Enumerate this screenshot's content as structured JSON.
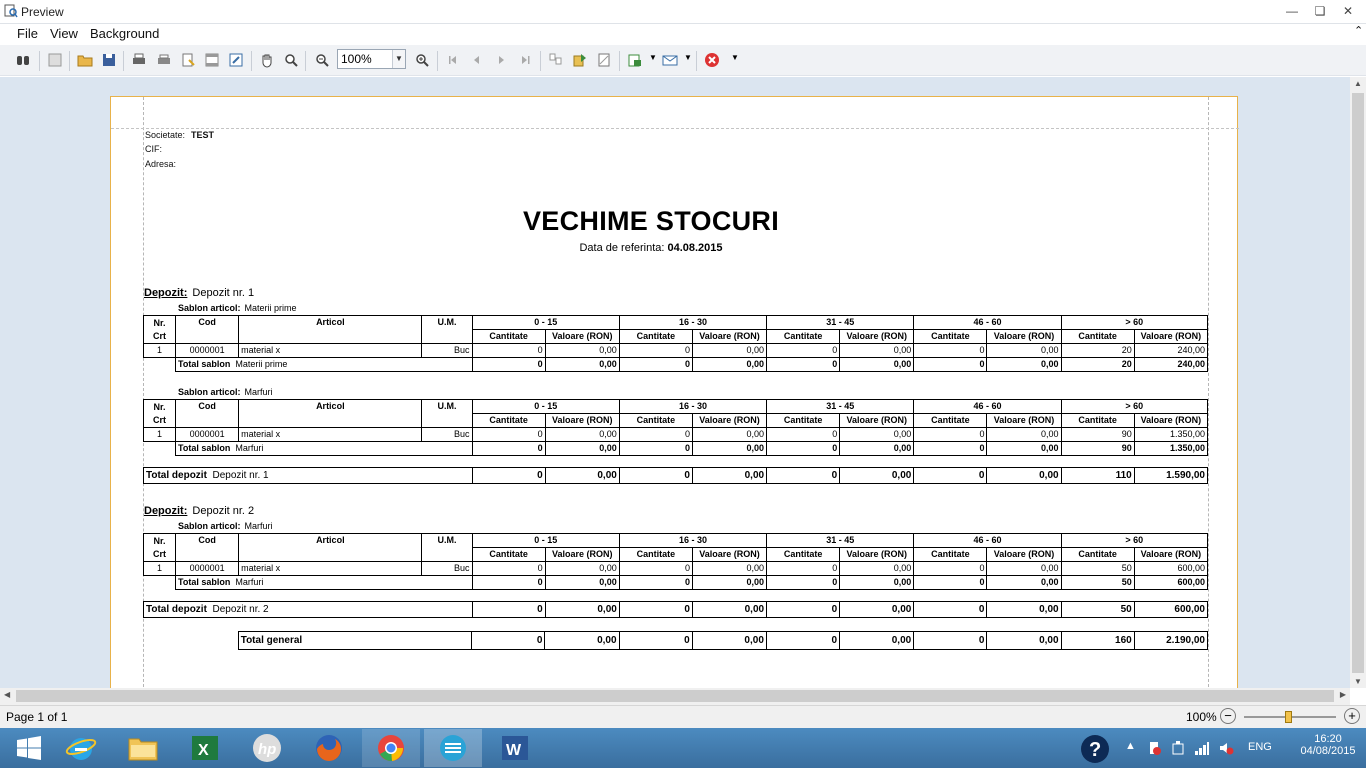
{
  "window": {
    "title": "Preview"
  },
  "menu": [
    "File",
    "View",
    "Background"
  ],
  "toolbar": {
    "zoom": "100%"
  },
  "report": {
    "header": {
      "societate_label": "Societate:",
      "societate_value": "TEST",
      "cif_label": "CIF:",
      "adresa_label": "Adresa:"
    },
    "title": "VECHIME STOCURI",
    "ref_label": "Data de referinta:",
    "ref_date": "04.08.2015",
    "col_headers": {
      "nr1": "Nr.",
      "nr2": "Crt",
      "cod": "Cod",
      "articol": "Articol",
      "um": "U.M.",
      "ranges": [
        "0 - 15",
        "16 - 30",
        "31 - 45",
        "46 - 60",
        "> 60"
      ],
      "cant": "Cantitate",
      "val": "Valoare (RON)"
    },
    "depozit_label": "Depozit:",
    "sablon_label": "Sablon articol:",
    "total_sablon_label": "Total sablon",
    "total_depozit_label": "Total depozit",
    "depozite": [
      {
        "name": "Depozit nr. 1",
        "groups": [
          {
            "sablon": "Materii prime",
            "row": {
              "nr": "1",
              "cod": "0000001",
              "articol": "material x",
              "um": "Buc",
              "vals": [
                "0",
                "0,00",
                "0",
                "0,00",
                "0",
                "0,00",
                "0",
                "0,00",
                "20",
                "240,00"
              ]
            },
            "total": [
              "0",
              "0,00",
              "0",
              "0,00",
              "0",
              "0,00",
              "0",
              "0,00",
              "20",
              "240,00"
            ]
          },
          {
            "sablon": "Marfuri",
            "row": {
              "nr": "1",
              "cod": "0000001",
              "articol": "material x",
              "um": "Buc",
              "vals": [
                "0",
                "0,00",
                "0",
                "0,00",
                "0",
                "0,00",
                "0",
                "0,00",
                "90",
                "1.350,00"
              ]
            },
            "total": [
              "0",
              "0,00",
              "0",
              "0,00",
              "0",
              "0,00",
              "0",
              "0,00",
              "90",
              "1.350,00"
            ]
          }
        ],
        "total": [
          "0",
          "0,00",
          "0",
          "0,00",
          "0",
          "0,00",
          "0",
          "0,00",
          "110",
          "1.590,00"
        ]
      },
      {
        "name": "Depozit nr. 2",
        "groups": [
          {
            "sablon": "Marfuri",
            "row": {
              "nr": "1",
              "cod": "0000001",
              "articol": "material x",
              "um": "Buc",
              "vals": [
                "0",
                "0,00",
                "0",
                "0,00",
                "0",
                "0,00",
                "0",
                "0,00",
                "50",
                "600,00"
              ]
            },
            "total": [
              "0",
              "0,00",
              "0",
              "0,00",
              "0",
              "0,00",
              "0",
              "0,00",
              "50",
              "600,00"
            ]
          }
        ],
        "total": [
          "0",
          "0,00",
          "0",
          "0,00",
          "0",
          "0,00",
          "0",
          "0,00",
          "50",
          "600,00"
        ]
      }
    ],
    "total_general_label": "Total general",
    "total_general": [
      "0",
      "0,00",
      "0",
      "0,00",
      "0",
      "0,00",
      "0",
      "0,00",
      "160",
      "2.190,00"
    ]
  },
  "status": {
    "page": "Page 1 of 1",
    "zoom": "100%"
  },
  "tray": {
    "lang": "ENG",
    "time": "16:20",
    "date": "04/08/2015"
  },
  "colors": {
    "accent": "#3a6e9e",
    "page_border": "#e8b24a",
    "viewport": "#dbe5f0"
  }
}
